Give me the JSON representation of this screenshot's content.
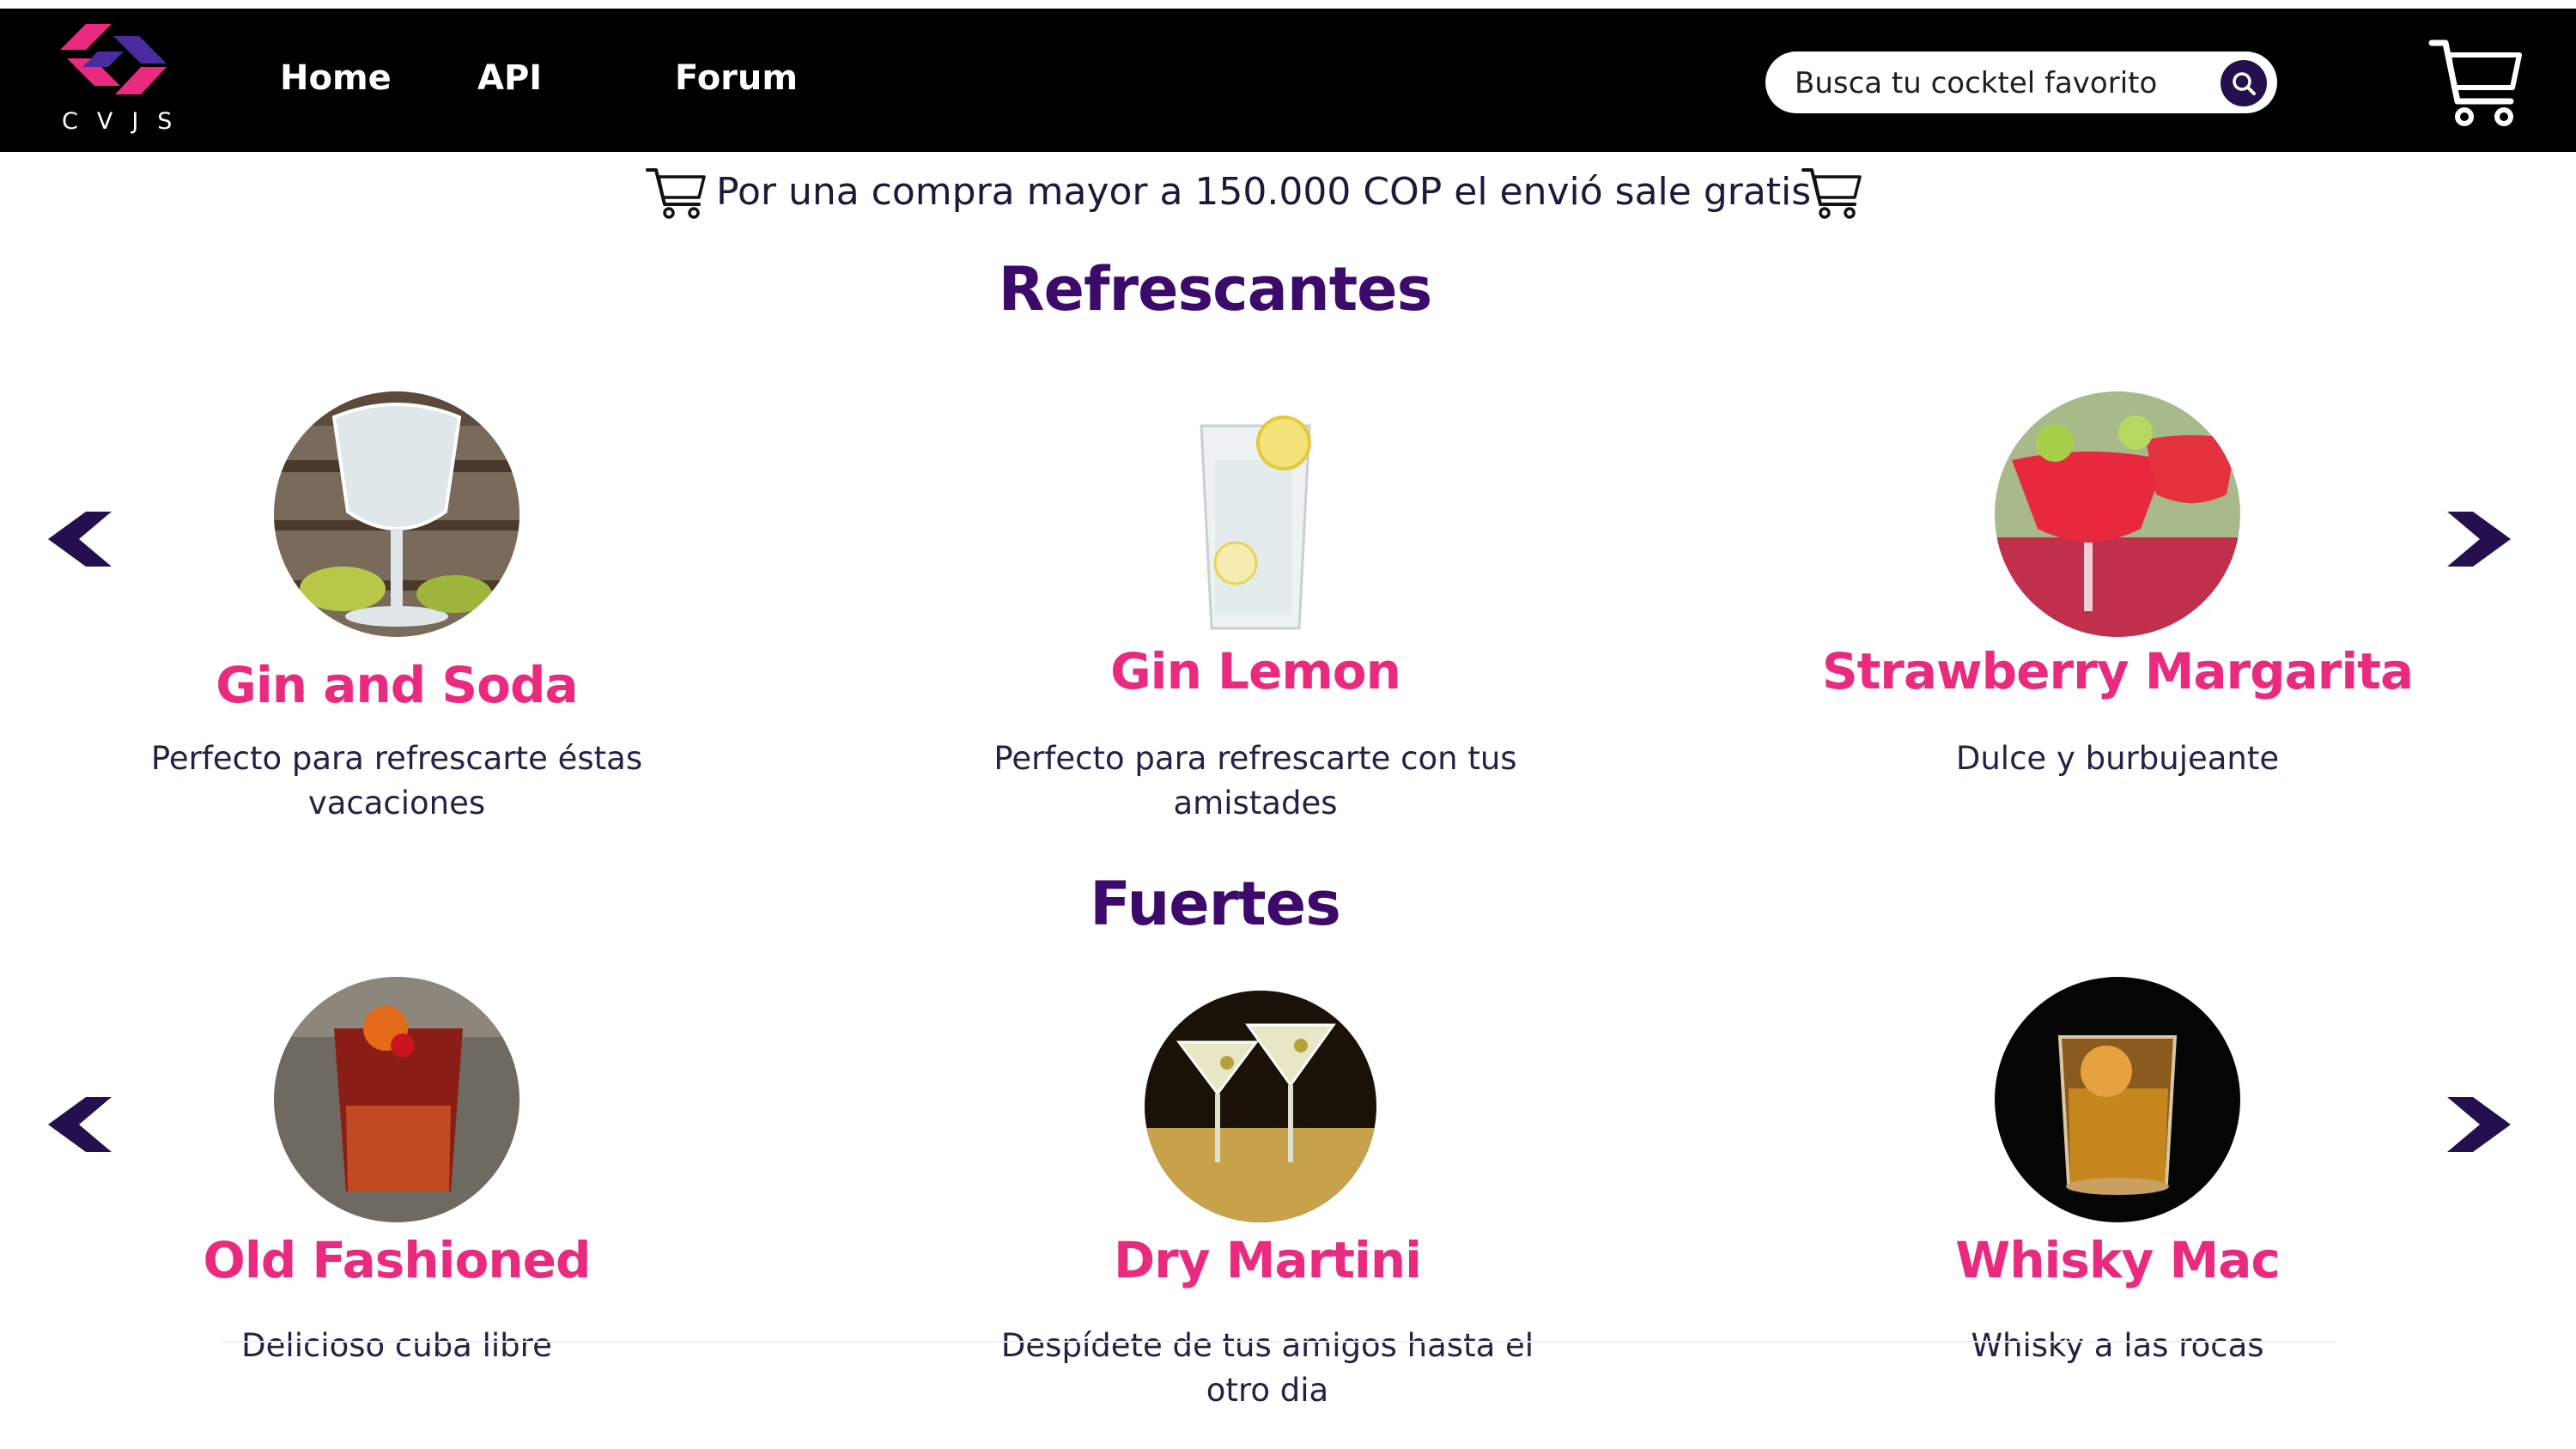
{
  "header": {
    "logo_text": "CVJS",
    "nav": [
      {
        "label": "Home"
      },
      {
        "label": "API"
      },
      {
        "label": "Forum"
      }
    ],
    "search": {
      "placeholder": "Busca tu cocktel favorito"
    },
    "icons": {
      "search": "search-icon",
      "cart": "shopping-cart-icon"
    }
  },
  "promo": {
    "text": "Por una compra mayor a 150.000 COP el envió sale gratis"
  },
  "sections": [
    {
      "title": "Refrescantes",
      "items": [
        {
          "name": "Gin and Soda",
          "desc": "Perfecto para refrescarte éstas vacaciones"
        },
        {
          "name": "Gin Lemon",
          "desc": "Perfecto para refrescarte con tus amistades"
        },
        {
          "name": "Strawberry Margarita",
          "desc": "Dulce y burbujeante"
        }
      ]
    },
    {
      "title": "Fuertes",
      "items": [
        {
          "name": "Old Fashioned",
          "desc": "Delicioso cuba libre"
        },
        {
          "name": "Dry Martini",
          "desc": "Despídete de tus amigos hasta el otro dia"
        },
        {
          "name": "Whisky Mac",
          "desc": "Whisky a las rocas"
        }
      ]
    }
  ],
  "colors": {
    "navbar": "#000000",
    "section_title": "#3b0a6a",
    "drink_name": "#ea2a7e",
    "arrow": "#24104e",
    "logo_pink": "#ea2a7e",
    "logo_purple": "#4b2ca0"
  }
}
